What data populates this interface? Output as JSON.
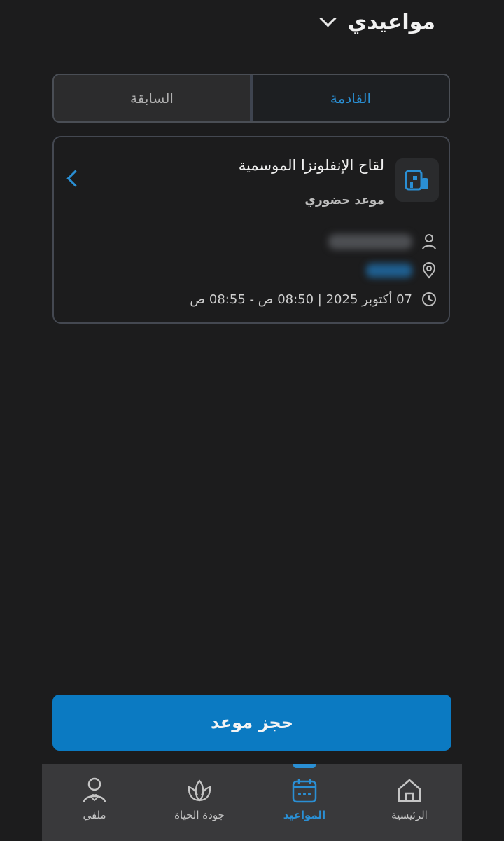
{
  "header": {
    "title": "مواعيدي"
  },
  "tabs": [
    {
      "label": "القادمة",
      "active": true
    },
    {
      "label": "السابقة",
      "active": false
    }
  ],
  "appointment": {
    "title": "لقاح الإنفلونزا الموسمية",
    "type": "موعد حضوري",
    "datetime": "07 أكتوبر 2025 | 08:50 ص - 08:55 ص",
    "icon": "clinic-icon"
  },
  "book_button": {
    "label": "حجز موعد"
  },
  "bottom_nav": {
    "items": [
      {
        "label": "الرئيسية",
        "icon": "home-icon",
        "active": false
      },
      {
        "label": "المواعيد",
        "icon": "calendar-icon",
        "active": true
      },
      {
        "label": "جودة الحياة",
        "icon": "lotus-icon",
        "active": false
      },
      {
        "label": "ملفي",
        "icon": "profile-icon",
        "active": false
      }
    ]
  },
  "colors": {
    "background": "#1c1c1d",
    "accent": "#2a8fd4",
    "button": "#0b7ac2",
    "nav_background": "#39393b"
  }
}
